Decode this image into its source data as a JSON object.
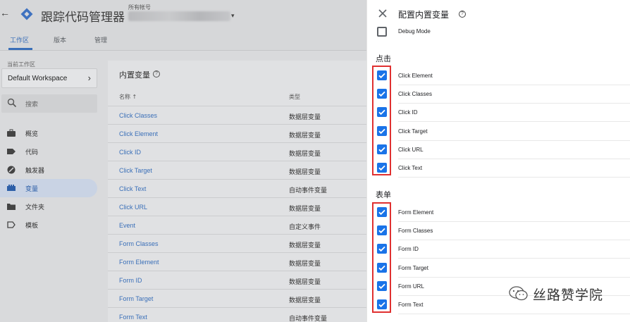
{
  "app": {
    "back": "←",
    "title": "跟踪代码管理器",
    "account_label": "所有帐号",
    "account_caret": "▾"
  },
  "tabs": [
    {
      "label": "工作区",
      "active": true
    },
    {
      "label": "版本",
      "active": false
    },
    {
      "label": "管理",
      "active": false
    }
  ],
  "sidebar": {
    "workspace_label": "当前工作区",
    "workspace_name": "Default Workspace",
    "workspace_chevron": "›",
    "search_placeholder": "搜索",
    "items": [
      {
        "label": "概览",
        "icon": "briefcase-icon"
      },
      {
        "label": "代码",
        "icon": "tag-icon"
      },
      {
        "label": "触发器",
        "icon": "trigger-icon"
      },
      {
        "label": "变量",
        "icon": "variables-icon",
        "active": true
      },
      {
        "label": "文件夹",
        "icon": "folder-icon"
      },
      {
        "label": "模板",
        "icon": "template-icon"
      }
    ]
  },
  "variables_card": {
    "title": "内置变量",
    "help": "?",
    "col_name": "名称 ↑",
    "col_type": "类型",
    "rows": [
      {
        "name": "Click Classes",
        "type": "数据层变量"
      },
      {
        "name": "Click Element",
        "type": "数据层变量"
      },
      {
        "name": "Click ID",
        "type": "数据层变量"
      },
      {
        "name": "Click Target",
        "type": "数据层变量"
      },
      {
        "name": "Click Text",
        "type": "自动事件变量"
      },
      {
        "name": "Click URL",
        "type": "数据层变量"
      },
      {
        "name": "Event",
        "type": "自定义事件"
      },
      {
        "name": "Form Classes",
        "type": "数据层变量"
      },
      {
        "name": "Form Element",
        "type": "数据层变量"
      },
      {
        "name": "Form ID",
        "type": "数据层变量"
      },
      {
        "name": "Form Target",
        "type": "数据层变量"
      },
      {
        "name": "Form Text",
        "type": "自动事件变量"
      }
    ]
  },
  "config_panel": {
    "title": "配置内置变量",
    "help": "?",
    "debug_item": {
      "label": "Debug Mode",
      "checked": false
    },
    "sections": [
      {
        "heading": "点击",
        "items": [
          {
            "label": "Click Element",
            "checked": true
          },
          {
            "label": "Click Classes",
            "checked": true
          },
          {
            "label": "Click ID",
            "checked": true
          },
          {
            "label": "Click Target",
            "checked": true
          },
          {
            "label": "Click URL",
            "checked": true
          },
          {
            "label": "Click Text",
            "checked": true
          }
        ]
      },
      {
        "heading": "表单",
        "items": [
          {
            "label": "Form Element",
            "checked": true
          },
          {
            "label": "Form Classes",
            "checked": true
          },
          {
            "label": "Form ID",
            "checked": true
          },
          {
            "label": "Form Target",
            "checked": true
          },
          {
            "label": "Form URL",
            "checked": true
          },
          {
            "label": "Form Text",
            "checked": true
          }
        ]
      }
    ]
  },
  "colors": {
    "accent": "#1a73e8",
    "highlight_box": "#e03030",
    "link": "#3a6fb8"
  },
  "watermark": {
    "text": "丝路赞学院",
    "icon": "wechat-icon"
  }
}
